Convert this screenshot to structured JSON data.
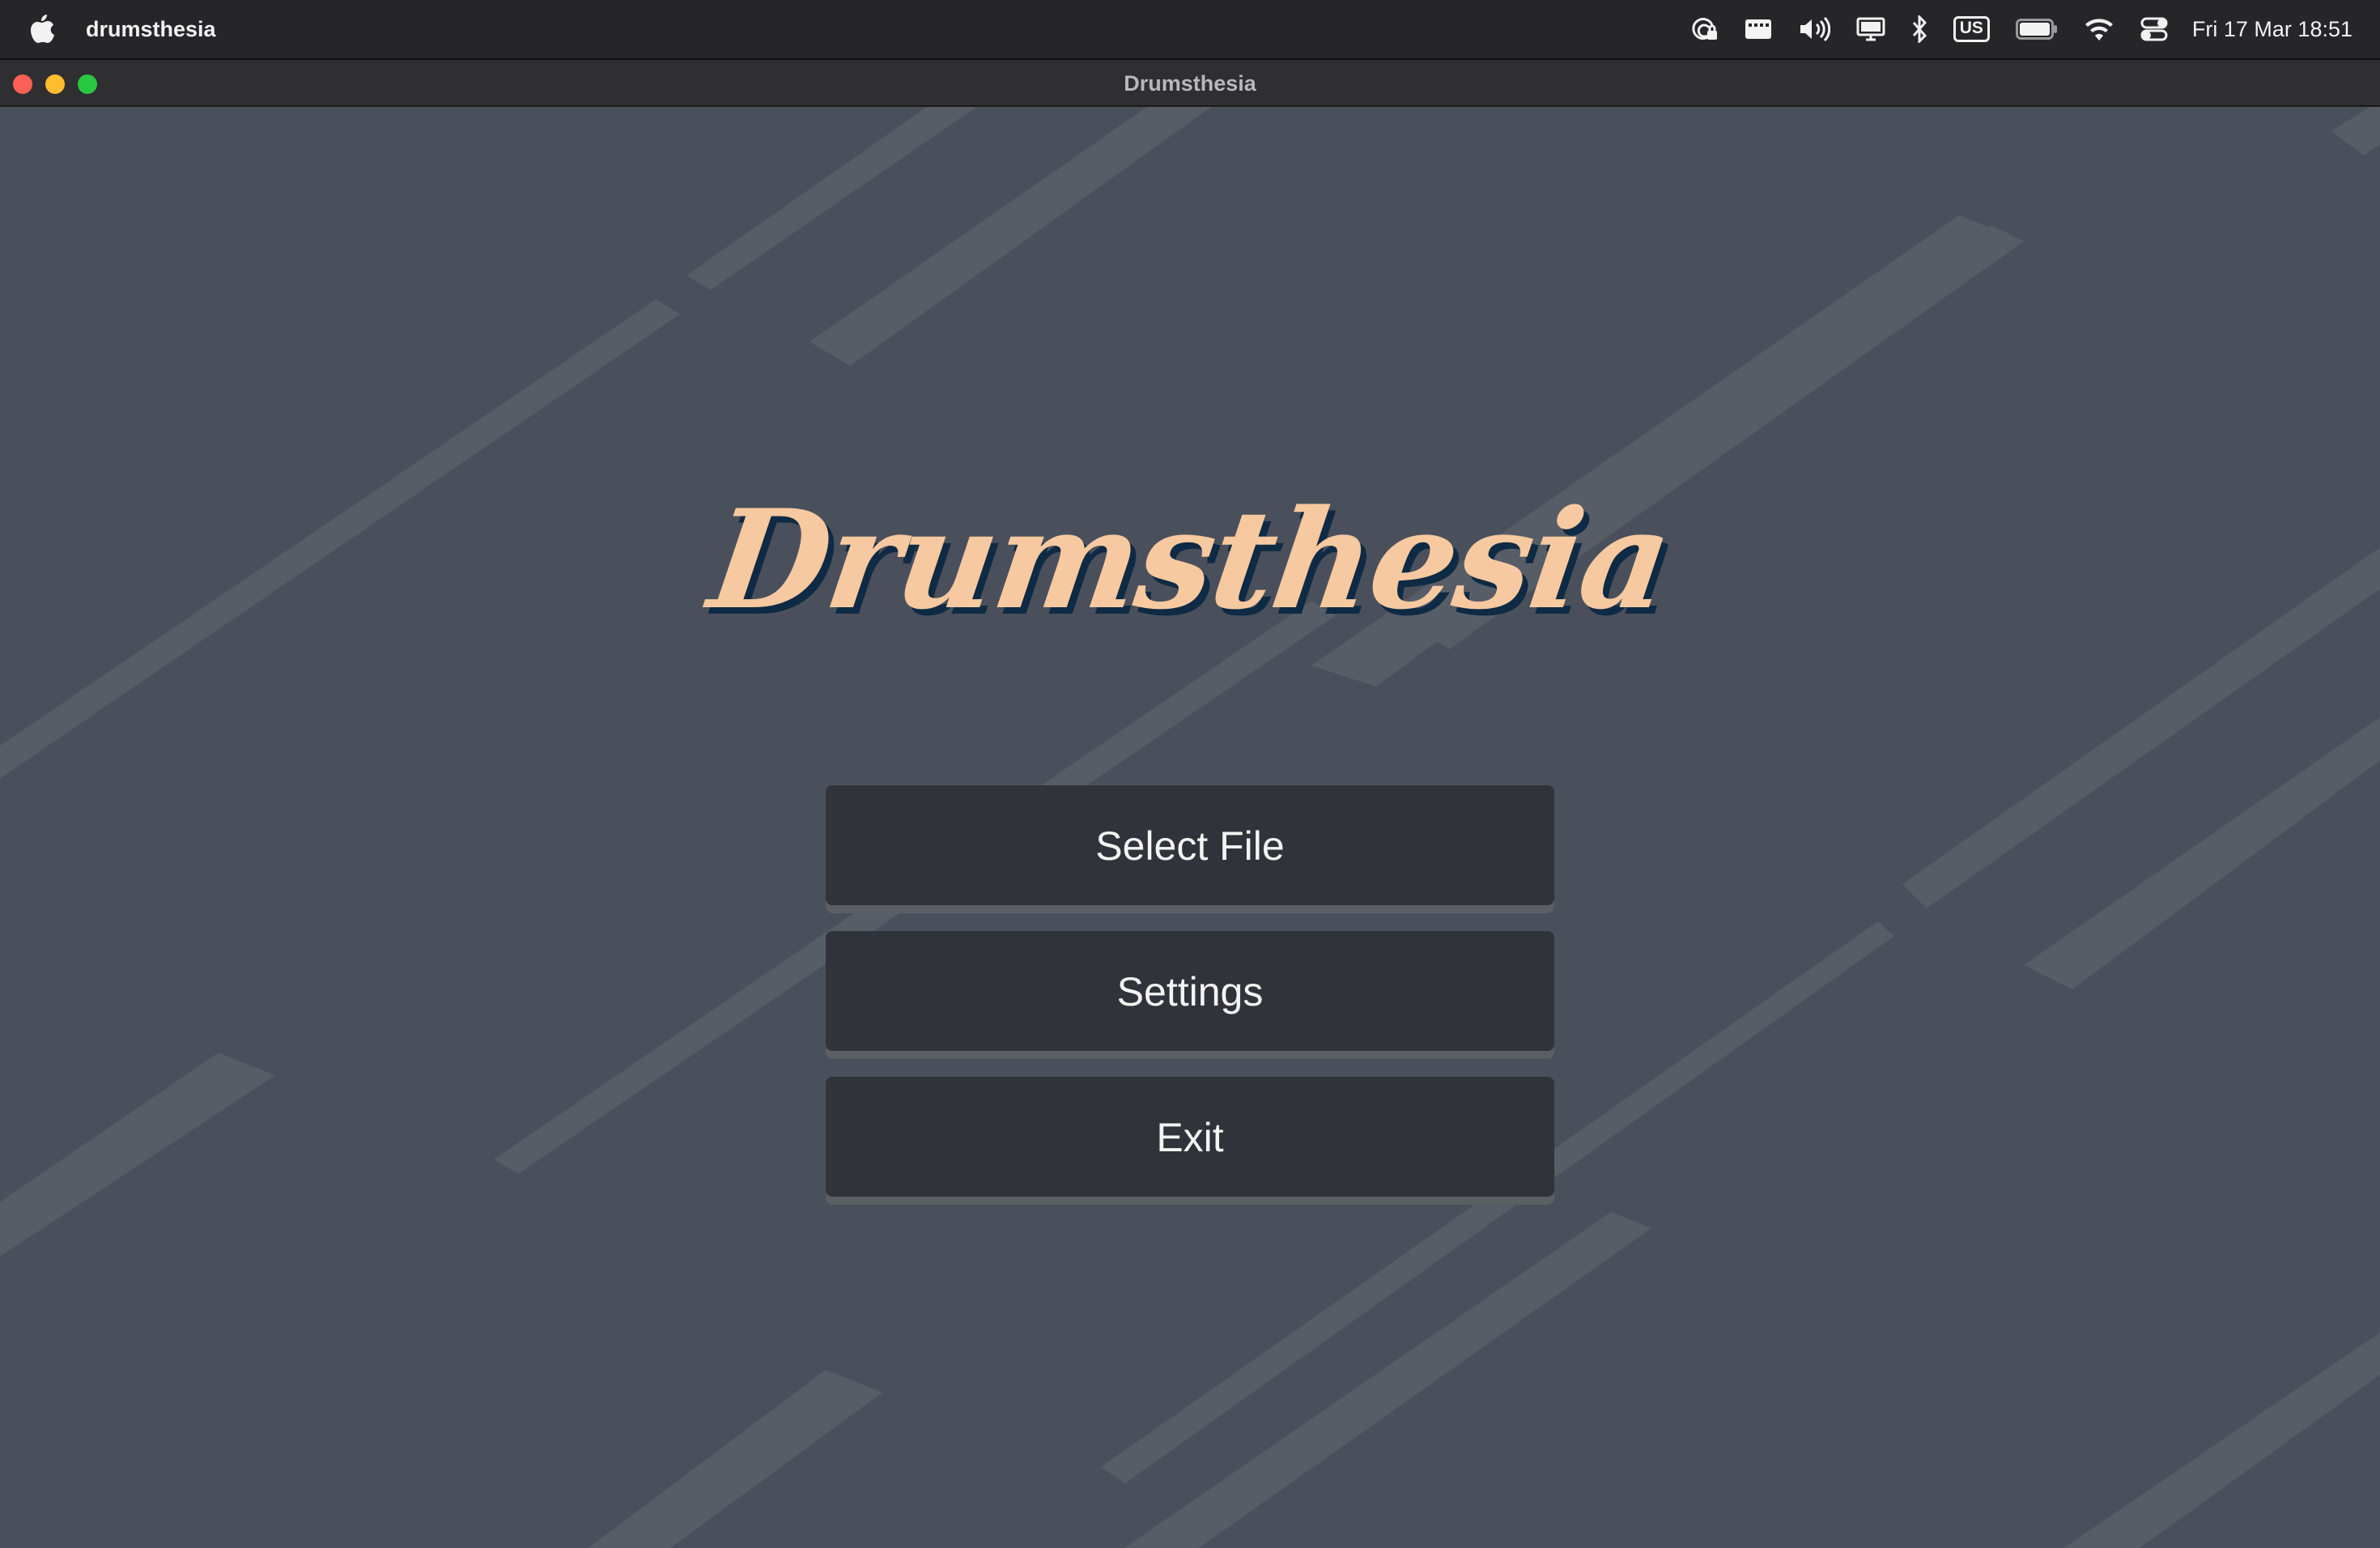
{
  "menubar": {
    "app_name": "drumsthesia",
    "keyboard_layout": "US",
    "clock": "Fri 17 Mar  18:51",
    "icons": [
      "apple-icon",
      "screen-lock-icon",
      "keyboard-brightness-icon",
      "volume-icon",
      "display-icon",
      "bluetooth-icon",
      "input-source-icon",
      "battery-icon",
      "wifi-icon",
      "control-center-icon"
    ]
  },
  "window": {
    "title": "Drumsthesia",
    "buttons": [
      "close",
      "minimize",
      "maximize"
    ]
  },
  "main": {
    "logo": "Drumsthesia",
    "menu": [
      {
        "label": "Select File"
      },
      {
        "label": "Settings"
      },
      {
        "label": "Exit"
      }
    ]
  },
  "colors": {
    "background": "#4a505b",
    "button": "#31333b",
    "logo_fill": "#f7c9a0",
    "logo_shadow": "#0f2a44"
  }
}
